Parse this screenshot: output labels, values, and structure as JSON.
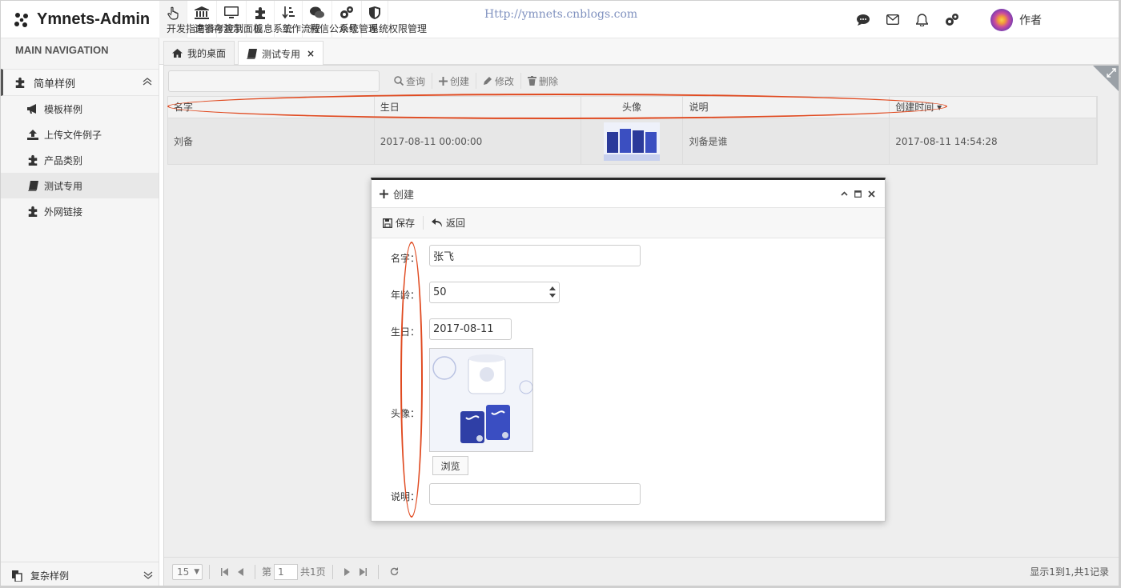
{
  "app": {
    "title": "Ymnets-Admin",
    "watermark": "Http://ymnets.cnblogs.com"
  },
  "topnav": [
    {
      "label": "开发指南参考",
      "icon": "hand-pointer-icon"
    },
    {
      "label": "进销存演示",
      "icon": "bank-icon"
    },
    {
      "label": "控制面板",
      "icon": "monitor-icon"
    },
    {
      "label": "信息系统",
      "icon": "puzzle-icon"
    },
    {
      "label": "工作流程",
      "icon": "sort-icon"
    },
    {
      "label": "微信公众号",
      "icon": "wechat-icon"
    },
    {
      "label": "系统管理",
      "icon": "gears-icon"
    },
    {
      "label": "系统权限管理",
      "icon": "shield-icon"
    }
  ],
  "user": {
    "name": "作者"
  },
  "sidebar": {
    "heading": "MAIN NAVIGATION",
    "group": "简单样例",
    "items": [
      {
        "label": "模板样例",
        "icon": "bullhorn-icon"
      },
      {
        "label": "上传文件例子",
        "icon": "upload-icon"
      },
      {
        "label": "产品类别",
        "icon": "puzzle-icon"
      },
      {
        "label": "测试专用",
        "icon": "book-icon",
        "active": true
      },
      {
        "label": "外网链接",
        "icon": "puzzle-icon"
      }
    ],
    "bottom_group": "复杂样例"
  },
  "tabs": [
    {
      "label": "我的桌面",
      "icon": "home-icon"
    },
    {
      "label": "测试专用",
      "icon": "book-icon",
      "active": true,
      "close": "×"
    }
  ],
  "toolbar": {
    "query": "查询",
    "create": "创建",
    "edit": "修改",
    "delete": "删除"
  },
  "grid": {
    "columns": [
      "名字",
      "生日",
      "头像",
      "说明",
      "创建时间"
    ],
    "rows": [
      {
        "name": "刘备",
        "birthday": "2017-08-11 00:00:00",
        "description": "刘备是谁",
        "created": "2017-08-11 14:54:28"
      }
    ]
  },
  "pager": {
    "page_size": "15",
    "page_prefix": "第",
    "page": "1",
    "page_total": "共1页",
    "info": "显示1到1,共1记录"
  },
  "dialog": {
    "title": "创建",
    "save": "保存",
    "back": "返回",
    "fields": {
      "name_label": "名字：",
      "name_value": "张飞",
      "age_label": "年龄：",
      "age_value": "50",
      "birthday_label": "生日：",
      "birthday_value": "2017-08-11",
      "avatar_label": "头像：",
      "browse": "浏览",
      "desc_label": "说明：",
      "desc_value": ""
    }
  },
  "colors": {
    "accent_oval": "#e04a20",
    "dialog_top": "#2a2a2a"
  }
}
